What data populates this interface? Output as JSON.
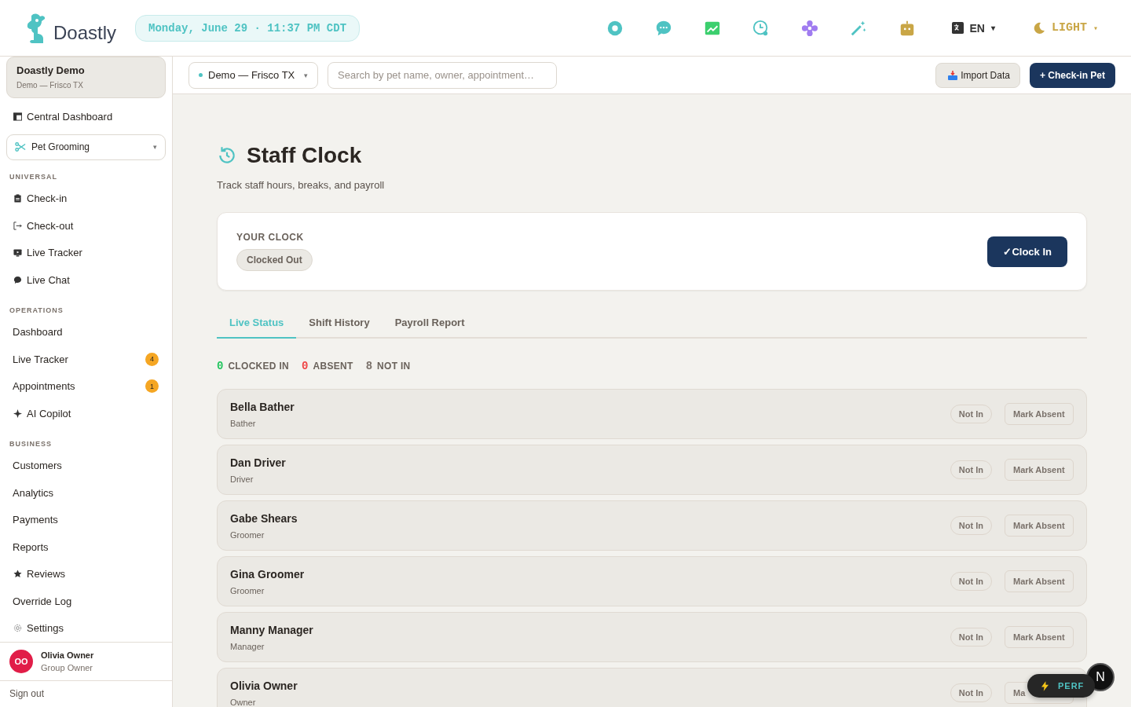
{
  "brand": {
    "name": "Doastly"
  },
  "date": "Monday, June 29 · 11:37 PM CDT",
  "header_icons": [
    {
      "kind": "lifebuoy",
      "color": "#4fc3c3"
    },
    {
      "kind": "chat",
      "color": "#4fc3c3"
    },
    {
      "kind": "chart",
      "color": "#3ccf6e"
    },
    {
      "kind": "clock",
      "color": "#4fc3c3"
    },
    {
      "kind": "flower",
      "color": "#a07cf0"
    },
    {
      "kind": "wand",
      "color": "#4fc3c3"
    },
    {
      "kind": "robot",
      "color": "#c9a646"
    }
  ],
  "language": "EN",
  "dropdown_caret": "▾",
  "theme": "LIGHT",
  "account": {
    "name": "Doastly Demo",
    "location": "Demo — Frisco TX"
  },
  "sidebar": {
    "top_link": "Central Dashboard",
    "module": "Pet Grooming",
    "sections": [
      {
        "title": "UNIVERSAL",
        "items": [
          {
            "label": "Check-in",
            "kind": "clipboard"
          },
          {
            "label": "Check-out",
            "kind": "exit"
          },
          {
            "label": "Live Tracker",
            "kind": "monitor"
          },
          {
            "label": "Live Chat",
            "kind": "bubble"
          }
        ]
      },
      {
        "title": "OPERATIONS",
        "items": [
          {
            "label": "Dashboard",
            "kind": "plain"
          },
          {
            "label": "Live Tracker",
            "kind": "plain",
            "badge": "4"
          },
          {
            "label": "Appointments",
            "kind": "plain",
            "badge": "1"
          },
          {
            "label": "AI Copilot",
            "kind": "sparkle"
          }
        ]
      },
      {
        "title": "BUSINESS",
        "items": [
          {
            "label": "Customers",
            "kind": "plain"
          },
          {
            "label": "Analytics",
            "kind": "plain"
          },
          {
            "label": "Payments",
            "kind": "plain"
          },
          {
            "label": "Reports",
            "kind": "plain"
          },
          {
            "label": "Reviews",
            "kind": "star"
          },
          {
            "label": "Override Log",
            "kind": "plain"
          },
          {
            "label": "Settings",
            "kind": "gear"
          }
        ]
      }
    ]
  },
  "user": {
    "initials": "OO",
    "name": "Olivia Owner",
    "role": "Group Owner"
  },
  "sign_out": "Sign out",
  "location_select": "Demo — Frisco TX",
  "search": {
    "placeholder": "Search by pet name, owner, appointment…"
  },
  "import_button": "Import Data",
  "checkin_button": "+ Check-in Pet",
  "page": {
    "title": "Staff Clock",
    "subtitle": "Track staff hours, breaks, and payroll"
  },
  "clock": {
    "label": "YOUR CLOCK",
    "status": "Clocked Out",
    "button": "✓Clock In"
  },
  "tabs": [
    {
      "label": "Live Status",
      "selected": true
    },
    {
      "label": "Shift History",
      "selected": false
    },
    {
      "label": "Payroll Report",
      "selected": false
    }
  ],
  "summary": [
    {
      "count": "0",
      "label": "CLOCKED IN",
      "color": "#22c55e"
    },
    {
      "count": "0",
      "label": "ABSENT",
      "color": "#ef4444"
    },
    {
      "count": "8",
      "label": "NOT IN",
      "color": "#7a716a"
    }
  ],
  "staff": [
    {
      "name": "Bella Bather",
      "role": "Bather",
      "status": "Not In",
      "action": "Mark Absent"
    },
    {
      "name": "Dan Driver",
      "role": "Driver",
      "status": "Not In",
      "action": "Mark Absent"
    },
    {
      "name": "Gabe Shears",
      "role": "Groomer",
      "status": "Not In",
      "action": "Mark Absent"
    },
    {
      "name": "Gina Groomer",
      "role": "Groomer",
      "status": "Not In",
      "action": "Mark Absent"
    },
    {
      "name": "Manny Manager",
      "role": "Manager",
      "status": "Not In",
      "action": "Mark Absent"
    },
    {
      "name": "Olivia Owner",
      "role": "Owner",
      "status": "Not In",
      "action": "Ma"
    }
  ],
  "perf": "PERF",
  "fab": "N"
}
